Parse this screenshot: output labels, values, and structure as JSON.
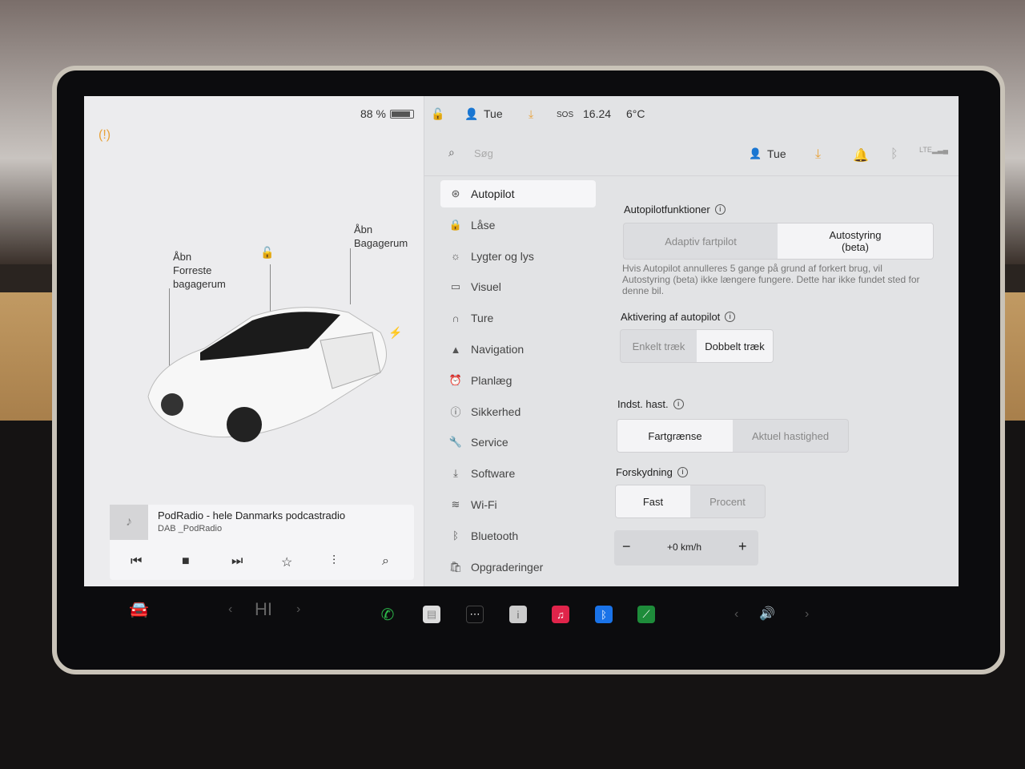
{
  "status_bar": {
    "battery": "88 %",
    "battery_level": 0.88,
    "user": "Tue",
    "sos": "SOS",
    "time": "16.24",
    "temperature": "6°C"
  },
  "car_panel": {
    "frunk_label": "Åbn\nForreste\nbagagerum",
    "trunk_label": "Åbn\nBagagerum"
  },
  "media": {
    "title": "PodRadio - hele Danmarks podcastradio",
    "source": "DAB _PodRadio"
  },
  "settings_header": {
    "search_placeholder": "Søg",
    "user": "Tue"
  },
  "menu": [
    {
      "label": "Autopilot",
      "icon": "steering-wheel-icon",
      "active": true
    },
    {
      "label": "Låse",
      "icon": "lock-icon"
    },
    {
      "label": "Lygter og lys",
      "icon": "light-icon"
    },
    {
      "label": "Visuel",
      "icon": "display-icon"
    },
    {
      "label": "Ture",
      "icon": "trips-icon"
    },
    {
      "label": "Navigation",
      "icon": "navigation-icon"
    },
    {
      "label": "Planlæg",
      "icon": "clock-icon"
    },
    {
      "label": "Sikkerhed",
      "icon": "safety-icon"
    },
    {
      "label": "Service",
      "icon": "wrench-icon"
    },
    {
      "label": "Software",
      "icon": "download-icon"
    },
    {
      "label": "Wi-Fi",
      "icon": "wifi-icon"
    },
    {
      "label": "Bluetooth",
      "icon": "bluetooth-icon"
    },
    {
      "label": "Opgraderinger",
      "icon": "shopping-bag-icon"
    }
  ],
  "autopilot": {
    "features_label": "Autopilotfunktioner",
    "features_options": [
      "Adaptiv fartpilot",
      "Autostyring (beta)"
    ],
    "features_selected": "Autostyring (beta)",
    "warning": "Hvis Autopilot annulleres 5 gange på grund af forkert brug, vil Autostyring (beta) ikke længere fungere. Dette har ikke fundet sted for denne bil.",
    "activation_label": "Aktivering af autopilot",
    "activation_options": [
      "Enkelt træk",
      "Dobbelt træk"
    ],
    "activation_selected": "Dobbelt træk",
    "speed_label": "Indst. hast.",
    "speed_options": [
      "Fartgrænse",
      "Aktuel hastighed"
    ],
    "speed_selected": "Fartgrænse",
    "offset_label": "Forskydning",
    "offset_options": [
      "Fast",
      "Procent"
    ],
    "offset_selected": "Fast",
    "offset_value": "+0 km/h"
  },
  "taskbar": {
    "climate": "HI"
  },
  "colors": {
    "accent_orange": "#e8a23a",
    "phone_green": "#2db84a",
    "music_red": "#e0244a",
    "bluetooth_blue": "#1a73e8",
    "chart_green": "#1e8c3a"
  }
}
